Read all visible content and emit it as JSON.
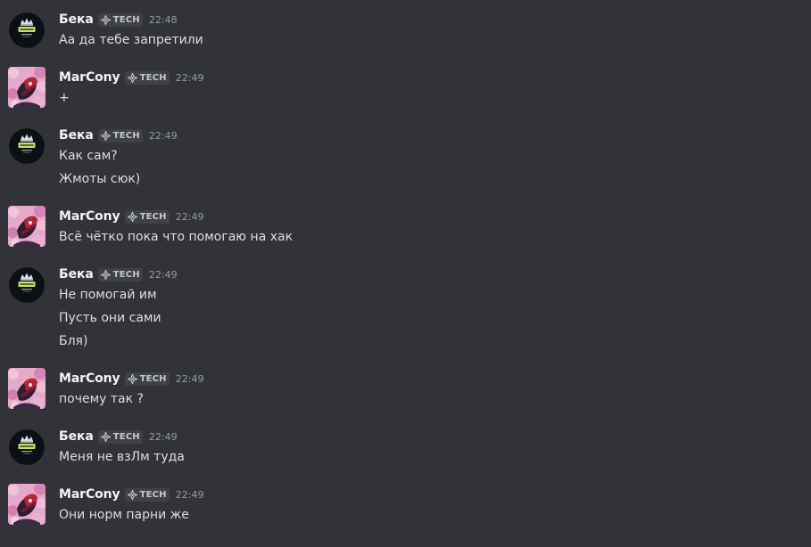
{
  "colors": {
    "background": "#313338",
    "username": "#f2f3f5",
    "text": "#dbdee1",
    "timestamp": "#949ba4",
    "tag_background": "#3f4147"
  },
  "messages": [
    {
      "author": "Бека",
      "tag": "TECH",
      "tag_icon": "diamond-icon",
      "time": "22:48",
      "avatar": "crown-badge-avatar",
      "lines": [
        "Аа да тебе запретили"
      ]
    },
    {
      "author": "MarCony",
      "tag": "TECH",
      "tag_icon": "diamond-icon",
      "time": "22:49",
      "avatar": "pink-anime-avatar",
      "lines": [
        "+"
      ]
    },
    {
      "author": "Бека",
      "tag": "TECH",
      "tag_icon": "diamond-icon",
      "time": "22:49",
      "avatar": "crown-badge-avatar",
      "lines": [
        "Как сам?",
        "Жмоты сюк)"
      ]
    },
    {
      "author": "MarCony",
      "tag": "TECH",
      "tag_icon": "diamond-icon",
      "time": "22:49",
      "avatar": "pink-anime-avatar",
      "lines": [
        "Всё чётко пока что помогаю на хак"
      ]
    },
    {
      "author": "Бека",
      "tag": "TECH",
      "tag_icon": "diamond-icon",
      "time": "22:49",
      "avatar": "crown-badge-avatar",
      "lines": [
        "Не помогай им",
        "Пусть они сами",
        "Бля)"
      ]
    },
    {
      "author": "MarCony",
      "tag": "TECH",
      "tag_icon": "diamond-icon",
      "time": "22:49",
      "avatar": "pink-anime-avatar",
      "lines": [
        "почему так  ?"
      ]
    },
    {
      "author": "Бека",
      "tag": "TECH",
      "tag_icon": "diamond-icon",
      "time": "22:49",
      "avatar": "crown-badge-avatar",
      "lines": [
        "Меня не взЛм туда"
      ]
    },
    {
      "author": "MarCony",
      "tag": "TECH",
      "tag_icon": "diamond-icon",
      "time": "22:49",
      "avatar": "pink-anime-avatar",
      "lines": [
        "Они норм парни же"
      ]
    }
  ]
}
